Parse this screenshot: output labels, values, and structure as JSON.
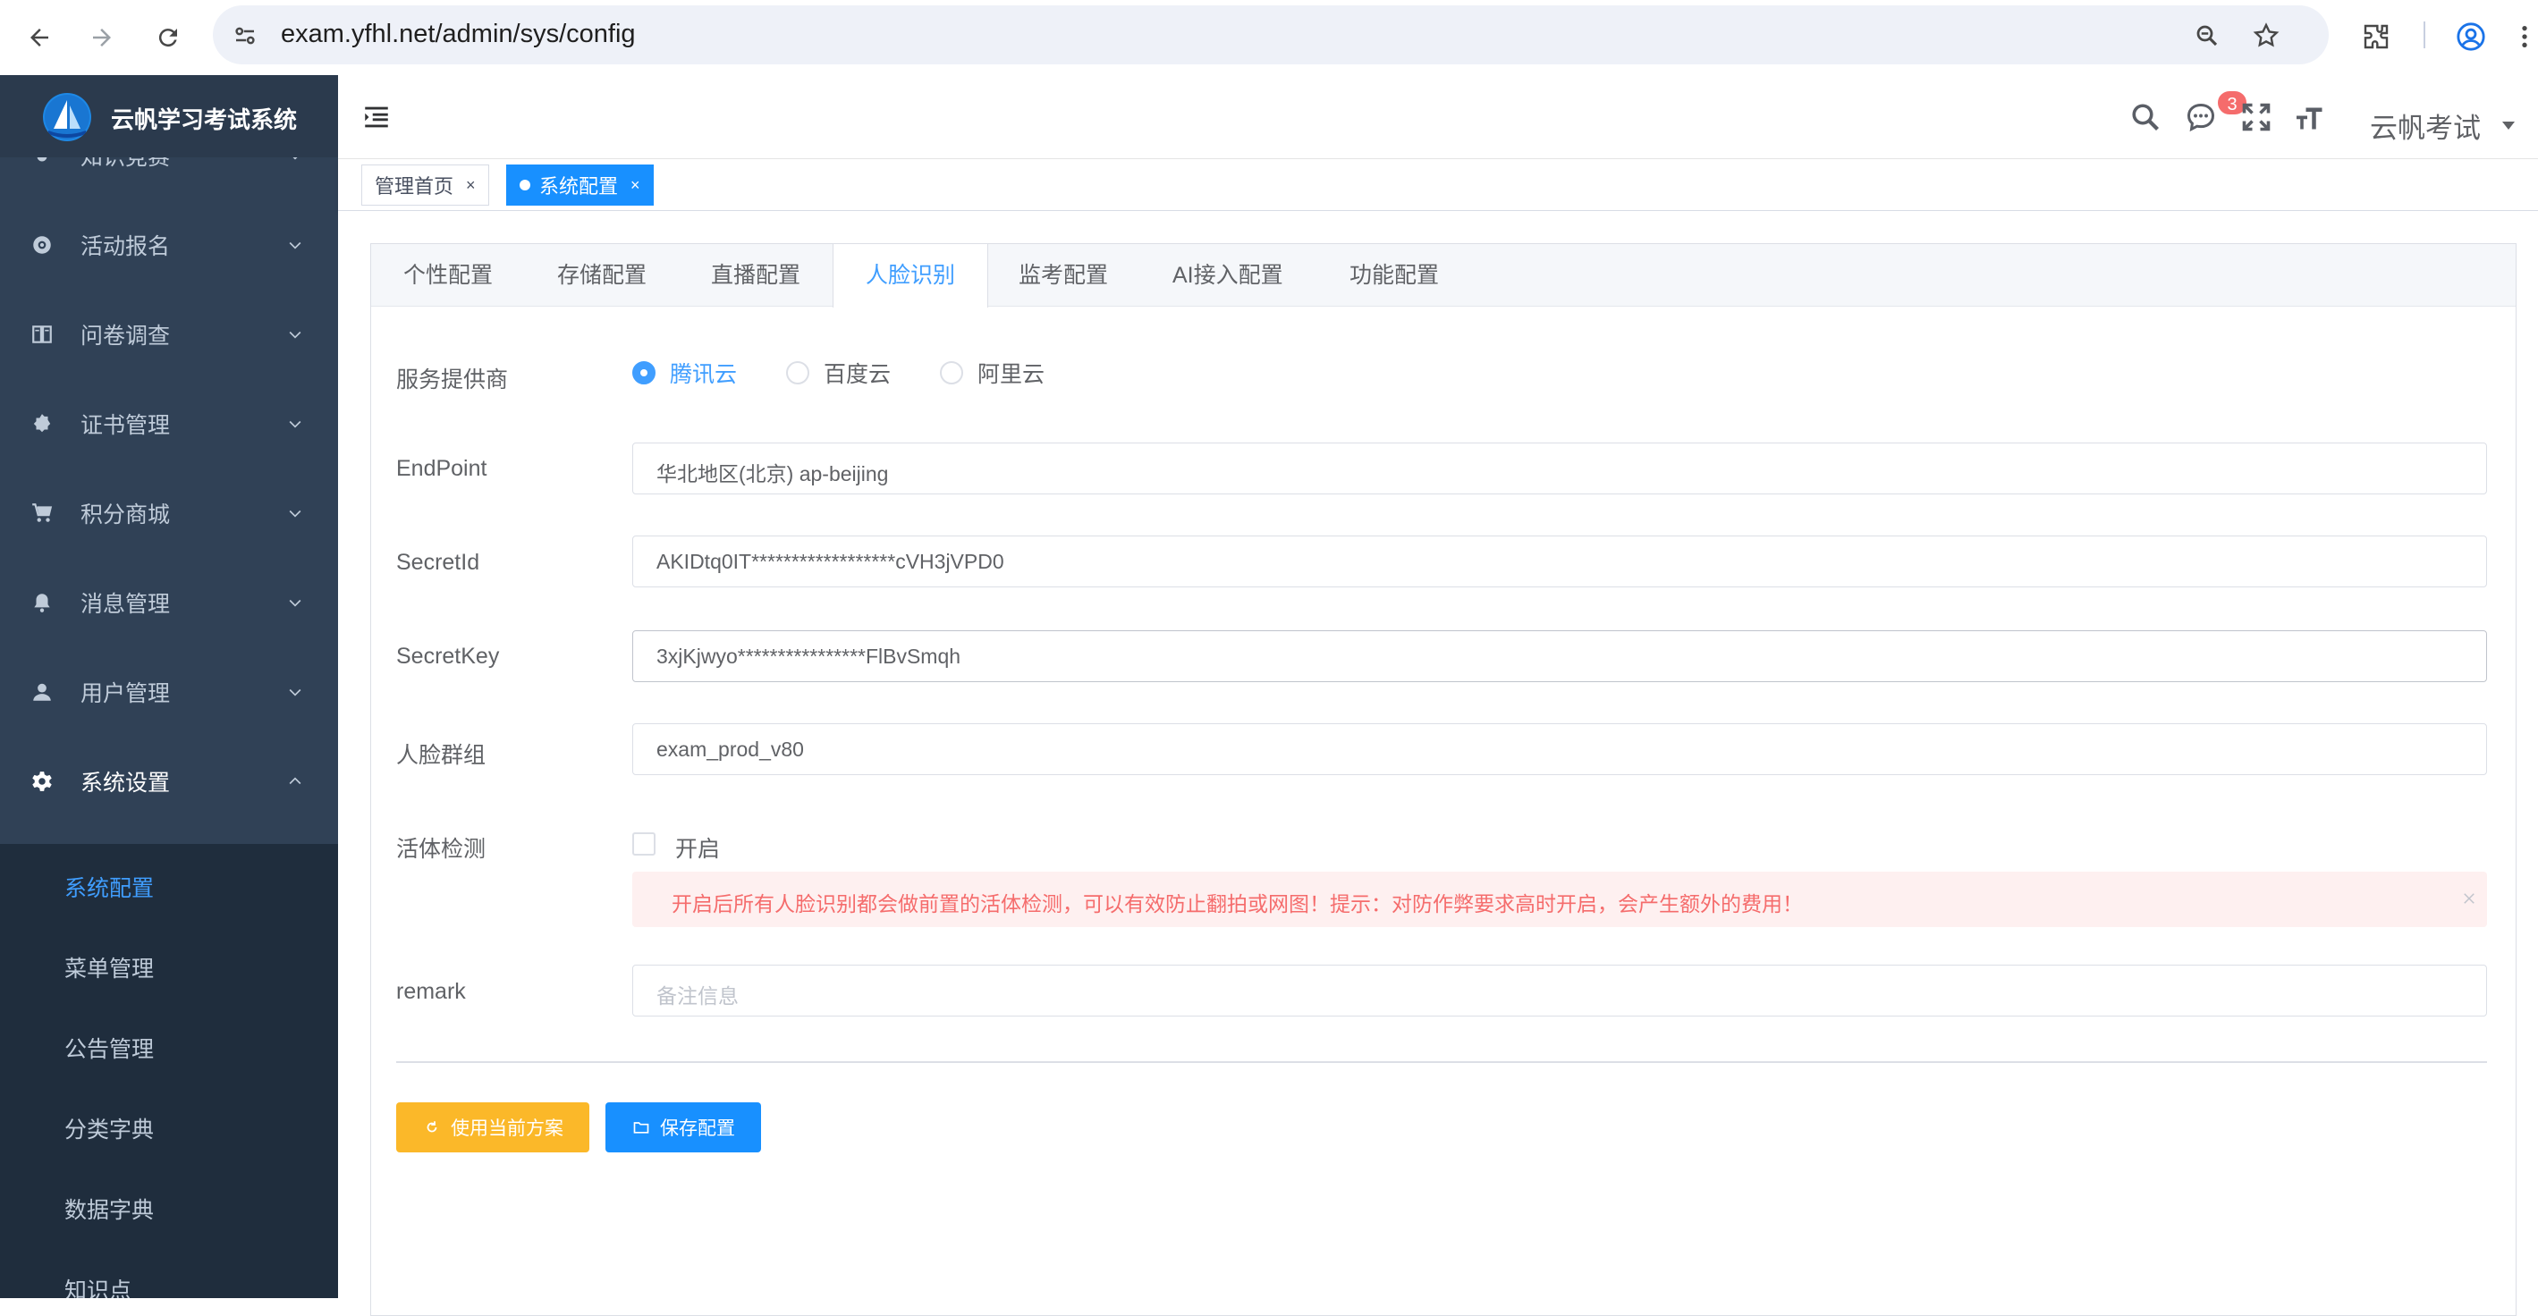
{
  "browser": {
    "url": "exam.yfhl.net/admin/sys/config"
  },
  "sidebar": {
    "app_name": "云帆学习考试系统",
    "menu": [
      {
        "label": "知识竞赛",
        "icon": "fire-icon"
      },
      {
        "label": "活动报名",
        "icon": "activity-icon"
      },
      {
        "label": "问卷调查",
        "icon": "survey-icon"
      },
      {
        "label": "证书管理",
        "icon": "certificate-icon"
      },
      {
        "label": "积分商城",
        "icon": "cart-icon"
      },
      {
        "label": "消息管理",
        "icon": "bell-icon"
      },
      {
        "label": "用户管理",
        "icon": "user-icon"
      },
      {
        "label": "系统设置",
        "icon": "gear-icon"
      }
    ],
    "submenu": [
      {
        "label": "系统配置",
        "active": true
      },
      {
        "label": "菜单管理"
      },
      {
        "label": "公告管理"
      },
      {
        "label": "分类字典"
      },
      {
        "label": "数据字典"
      },
      {
        "label": "知识点"
      }
    ]
  },
  "header": {
    "notification_count": "3",
    "username": "云帆考试"
  },
  "tags": [
    {
      "label": "管理首页"
    },
    {
      "label": "系统配置",
      "active": true
    }
  ],
  "tabs": [
    "个性配置",
    "存储配置",
    "直播配置",
    "人脸识别",
    "监考配置",
    "AI接入配置",
    "功能配置"
  ],
  "active_tab": "人脸识别",
  "form": {
    "provider_label": "服务提供商",
    "providers": [
      "腾讯云",
      "百度云",
      "阿里云"
    ],
    "selected_provider": "腾讯云",
    "endpoint_label": "EndPoint",
    "endpoint_value": "华北地区(北京) ap-beijing",
    "secret_id_label": "SecretId",
    "secret_id_value": "AKIDtq0IT******************cVH3jVPD0",
    "secret_key_label": "SecretKey",
    "secret_key_value": "3xjKjwyo****************FlBvSmqh",
    "group_label": "人脸群组",
    "group_value": "exam_prod_v80",
    "liveness_label": "活体检测",
    "liveness_checkbox_label": "开启",
    "liveness_enabled": false,
    "alert_text": "开启后所有人脸识别都会做前置的活体检测，可以有效防止翻拍或网图！提示：对防作弊要求高时开启，会产生额外的费用！",
    "remark_label": "remark",
    "remark_placeholder": "备注信息"
  },
  "buttons": {
    "use_current": "使用当前方案",
    "save": "保存配置"
  },
  "colors": {
    "sidebar_bg": "#304156",
    "primary": "#409eff",
    "warning": "#fbb829",
    "danger": "#f56c6c"
  }
}
